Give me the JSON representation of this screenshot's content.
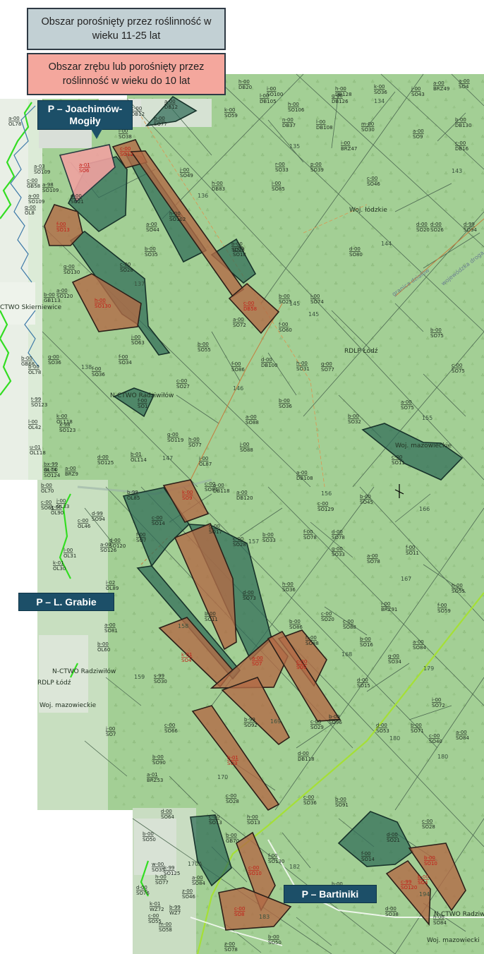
{
  "legend": {
    "young_forest": "Obszar porośnięty przez roślinność w wieku 11-25 lat",
    "clearcut": "Obszar zrębu lub porośnięty przez roślinność w wieku do 10 lat"
  },
  "callouts": {
    "joachimow": "P – Joachimów-Mogiły",
    "grabie": "P – L. Grabie",
    "bartiniki": "P – Bartiniki"
  },
  "colors": {
    "forest_green": "#a3cf95",
    "young_forest": "#2f6b58",
    "clearcut": "#b26a46",
    "clearcut_pink": "#f0a1a0",
    "callout_bg": "#1c4f68",
    "road_green": "#a5e035",
    "boundary_green": "#33dd22"
  },
  "admin_labels": {
    "woj_lodzkie": "Woj. łódzkie",
    "woj_mazowieckie": "Woj. mazowieckie",
    "woj_mazowieckie_2": "Woj. mazowieckie",
    "rdlp_lodz": "RDLP Łódź",
    "rdlp_lodz_2": "RDLP Łódź",
    "ctwo_skierniewice": "CTWO Skierniewice",
    "nctwo_radziwilow": "N-CTWO Radziwiłów",
    "nctwo_radziwilow_2": "N-CTWO Radziwiłów",
    "radziwilow_short": "N-CTWO Radziwiłów",
    "woj_mazowiecki_3": "Woj. mazowiecki",
    "rdlp_lodz_3": "RDLP Łódź",
    "woj_mazowieckie_4": "Woj. mazowieckie",
    "granica_label": "granica działów",
    "radziwilow_road": "wojewódzka droga"
  },
  "compartments": [
    "134",
    "135",
    "136",
    "137",
    "138",
    "143",
    "144",
    "145",
    "145",
    "146",
    "147",
    "155",
    "156",
    "157",
    "158",
    "159",
    "166",
    "167",
    "168",
    "169",
    "170",
    "170A",
    "179",
    "180",
    "180",
    "182",
    "183",
    "194"
  ],
  "highlighted_labels": [
    "a-01 SO6",
    "f-00 SO13",
    "h-00 SO130",
    "c-00 DB58",
    "c-00 SO12",
    "k-00 SO9",
    "k-01 SO4",
    "a-00 SO7",
    "c-00 SO9",
    "b-01 SO3",
    "c-00 SO10",
    "c-00 SO8",
    "c-99 SO120",
    "b-00 SO4",
    "b-00 SO10",
    "f-00 SO1",
    "h-00 SO102",
    "b-00 SO18",
    "d-00 SO21"
  ],
  "map_labels": [
    "h-00 DB20",
    "i-00 SO100",
    "h-00 DB128",
    "k-00 SO36",
    "j-00 SO43",
    "a-00 BRZ49",
    "a-00 SO4",
    "k-00 SO59",
    "l-00 DB105",
    "h-00 SO106",
    "g-00 DB126",
    "n-00 DB37",
    "l-00 DB108",
    "m-00 SO30",
    "b-00 DB130",
    "a-00 DB12",
    "i-00 SO38",
    "b-00 SO77",
    "j-00 SO49",
    "a-00 SO9",
    "c-00 DB16",
    "r-00 SO33",
    "p-00 SO39",
    "i-00 BRZ47",
    "c-00 SO46",
    "i-00 SO85",
    "h-00 DB83",
    "a-00 SO44",
    "d-00 SO20",
    "d-00 SO26",
    "d-99 SO94",
    "b-00 SO35",
    "c-00 SO28",
    "g-00 SO18",
    "d-00 SO80",
    "g-00 SO130",
    "a-00 SO120",
    "b-00 GB113",
    "i-00 SO74",
    "b-00 SO25",
    "a-00 SO72",
    "f-00 SO60",
    "b-00 SO75",
    "j-00 SO63",
    "f-00 SO34",
    "b-00 SO55",
    "f-00 SO86",
    "d-00 DB100",
    "h-00 SO31",
    "g-00 SO77",
    "c-00 SO75",
    "f-00 SO36",
    "g-00 SO36",
    "c-00 SO27",
    "a-00 SO88",
    "b-00 SO36",
    "a-00 SO75",
    "b-00 SO32",
    "c-00 SO11",
    "g-00 SO119",
    "h-00 SO77",
    "i-00 OL87",
    "j-00 SO88",
    "d-00 SO125",
    "b-01 OL114",
    "a-00 BRZ9",
    "a-00 DB108",
    "c-00 SO81",
    "a-00 DB120",
    "b-00 SO45",
    "c-00 SO129",
    "c-00 SO14",
    "f-00 SO7",
    "d-00 SO17",
    "c-00 SO28",
    "b-00 SO33",
    "f-00 SO78",
    "d-00 SO78",
    "g-00 SO33",
    "d-00 SO120",
    "a-00 SO78",
    "f-00 SO11",
    "d-00 SO73",
    "i-00 BRZ91",
    "h-00 SO55",
    "h-00 SO36",
    "f-00 SO59",
    "c-00 SO20",
    "b-00 SO11",
    "a-00 SO81",
    "b-00 SO86",
    "c-00 SO88",
    "b-00 SO16",
    "h-00 SO88",
    "g-00 SO34",
    "a-00 SO84",
    "i-00 SO72",
    "d-00 SO15",
    "b-00 SO96",
    "c-00 SO29",
    "d-00 SO53",
    "b-00 SO71",
    "c-00 SO40",
    "a-00 SO84",
    "b-99 SO92",
    "d-00 DB118",
    "c-00 SO66",
    "b-00 SO90",
    "c-00 SO28",
    "b-00 SO91",
    "c-00 SO36",
    "c-00 SO13",
    "h-00 SO13",
    "d-00 SO21",
    "f-00 SO14",
    "c-00 SO28",
    "f-00 SO130",
    "b-00 SO18",
    "a-00 SO90",
    "d-00 SO38",
    "h-00 SO84",
    "d-00 SO64",
    "c-00 SO55",
    "b-00 SO50",
    "z-00 SO46",
    "w-00 SO35",
    "a-01 BRZ53",
    "d-00 SO76",
    "h-00 SO77",
    "c-00 SO61",
    "k-00 OL90",
    "c-00 OL46",
    "b-00 OL70",
    "b-00 GB68",
    "a-00 OL78",
    "k-00 OL89",
    "f-00 OL55"
  ],
  "mixed_labels": [
    "a-03 SO109",
    "a-98 SO109",
    "a-00 SO109",
    "g-00 OL8",
    "c-00 GB58",
    "b-00 OL78",
    "t-99 SO123",
    "x-98 SO123",
    "k-00 OL118",
    "l-00 OL42",
    "u-01 OL118",
    "ax-00 SO124",
    "bx-99 OL74",
    "j-00 OL33",
    "b-99 OL85",
    "d-99 SO94",
    "a-00 SO126",
    "l-00 OL31",
    "k-01 OL30",
    "i-02 OL89",
    "b-00 OL60",
    "s-99 SO30",
    "j-00 SO7",
    "k-99 SO125",
    "a-00 SO84",
    "b-99 WZ7",
    "k-01 WZ72",
    "m-00 SO58",
    "z-00 SO78",
    "b-00 SO50",
    "b-00 GB70",
    "a-00 DB118",
    "c-00 DB12"
  ]
}
